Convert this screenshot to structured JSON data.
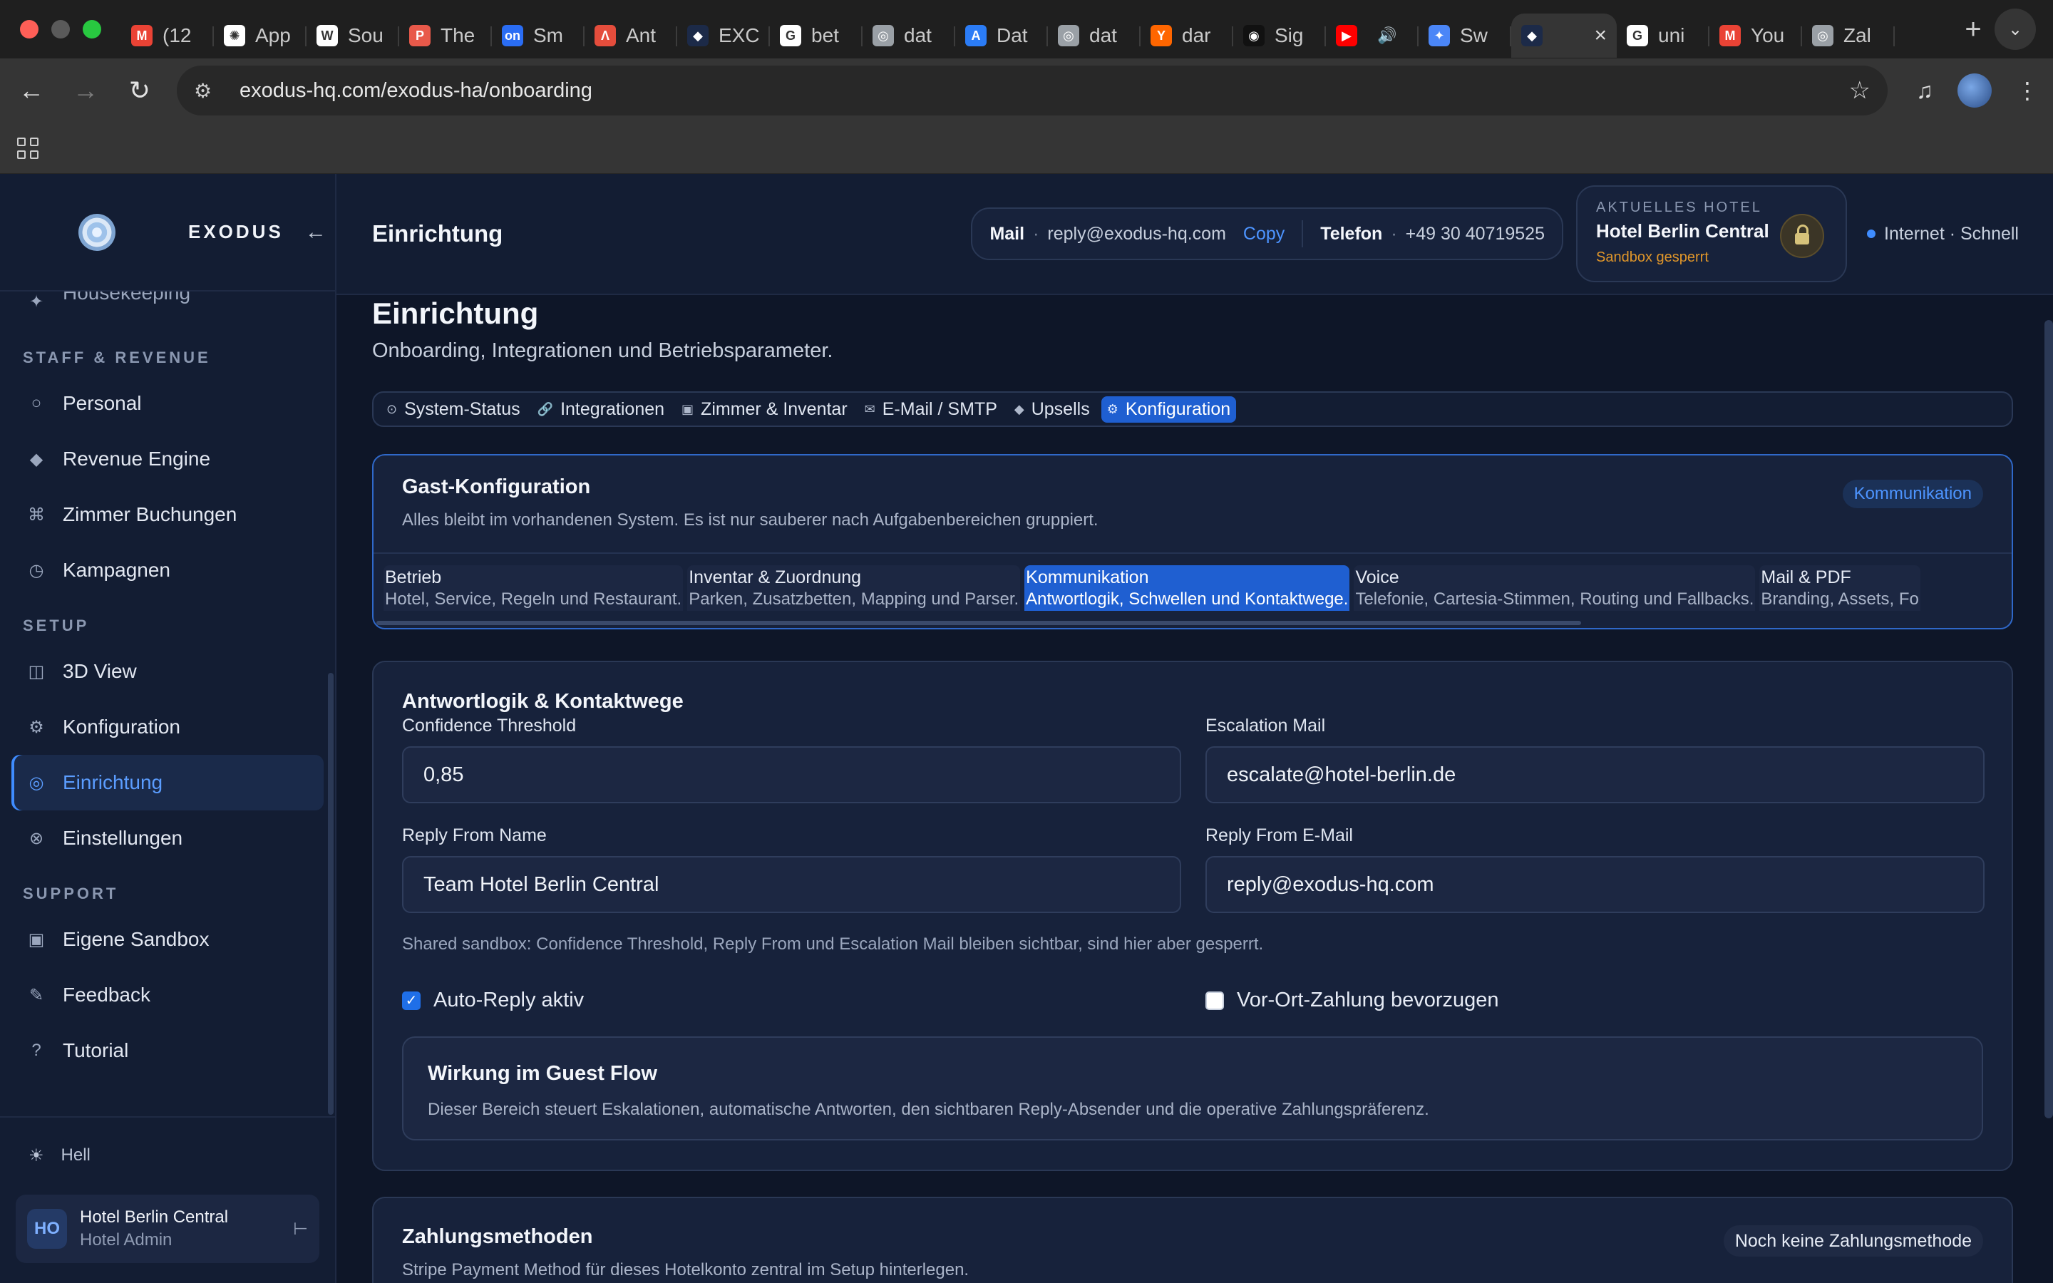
{
  "browser": {
    "tabs": [
      {
        "label": "(12",
        "icon": "gmail-icon",
        "color": "#ea4335",
        "glyph": "M"
      },
      {
        "label": "App",
        "icon": "openai-icon",
        "color": "#ffffff",
        "glyph": "✺"
      },
      {
        "label": "Sou",
        "icon": "wiki-icon",
        "color": "#ffffff",
        "glyph": "W"
      },
      {
        "label": "The",
        "icon": "p-icon",
        "color": "#e8594a",
        "glyph": "P"
      },
      {
        "label": "Sm",
        "icon": "on-icon",
        "color": "#2a6df4",
        "glyph": "on"
      },
      {
        "label": "Ant",
        "icon": "a-icon",
        "color": "#e54d3c",
        "glyph": "Λ"
      },
      {
        "label": "EXC",
        "icon": "exodus-icon",
        "color": "#1c2a48",
        "glyph": "◆"
      },
      {
        "label": "bet",
        "icon": "google-icon",
        "color": "#ffffff",
        "glyph": "G"
      },
      {
        "label": "dat",
        "icon": "globe-icon",
        "color": "#9aa0a6",
        "glyph": "◎"
      },
      {
        "label": "Dat",
        "icon": "appstore-icon",
        "color": "#2b7cf6",
        "glyph": "A"
      },
      {
        "label": "dat",
        "icon": "globe-icon",
        "color": "#9aa0a6",
        "glyph": "◎"
      },
      {
        "label": "dar",
        "icon": "ycombinator-icon",
        "color": "#ff6600",
        "glyph": "Y"
      },
      {
        "label": "Sig",
        "icon": "signal-icon",
        "color": "#111111",
        "glyph": "◉"
      },
      {
        "label": "",
        "icon": "youtube-icon",
        "color": "#ff0000",
        "glyph": "▶"
      },
      {
        "label": "Sw",
        "icon": "gemini-icon",
        "color": "#4b86f7",
        "glyph": "✦"
      },
      {
        "label": "",
        "icon": "exodus-icon",
        "color": "#1c2a48",
        "glyph": "◆",
        "active": true
      },
      {
        "label": "uni",
        "icon": "google-icon",
        "color": "#ffffff",
        "glyph": "G"
      },
      {
        "label": "You",
        "icon": "gmail-icon",
        "color": "#ea4335",
        "glyph": "M"
      },
      {
        "label": "Zal",
        "icon": "globe-icon",
        "color": "#9aa0a6",
        "glyph": "◎"
      }
    ],
    "url": "exodus-hq.com/exodus-ha/onboarding"
  },
  "sidebar": {
    "brand": "EXODUS",
    "partial_item": "Housekeeping",
    "sections": [
      {
        "title": "STAFF & REVENUE",
        "items": [
          {
            "label": "Personal",
            "icon": "○"
          },
          {
            "label": "Revenue Engine",
            "icon": "◆"
          },
          {
            "label": "Zimmer Buchungen",
            "icon": "⌘"
          },
          {
            "label": "Kampagnen",
            "icon": "◷"
          }
        ]
      },
      {
        "title": "SETUP",
        "items": [
          {
            "label": "3D View",
            "icon": "◫"
          },
          {
            "label": "Konfiguration",
            "icon": "⚙"
          },
          {
            "label": "Einrichtung",
            "icon": "◎",
            "active": true
          },
          {
            "label": "Einstellungen",
            "icon": "⊗"
          }
        ]
      },
      {
        "title": "SUPPORT",
        "items": [
          {
            "label": "Eigene Sandbox",
            "icon": "▣"
          },
          {
            "label": "Feedback",
            "icon": "✎"
          },
          {
            "label": "Tutorial",
            "icon": "?"
          }
        ]
      }
    ],
    "theme_label": "Hell",
    "user": {
      "initials": "HO",
      "name": "Hotel Berlin Central",
      "role": "Hotel Admin"
    }
  },
  "topbar": {
    "title": "Einrichtung",
    "mail_key": "Mail",
    "mail_value": "reply@exodus-hq.com",
    "copy_label": "Copy",
    "phone_key": "Telefon",
    "phone_value": "+49 30 40719525",
    "hotel_label": "AKTUELLES HOTEL",
    "hotel_name": "Hotel Berlin Central",
    "hotel_status": "Sandbox gesperrt",
    "net_status": "Internet · Schnell"
  },
  "page": {
    "title": "Einrichtung",
    "subtitle": "Onboarding, Integrationen und Betriebsparameter.",
    "section_nav": [
      {
        "label": "System-Status",
        "icon": "⊙"
      },
      {
        "label": "Integrationen",
        "icon": "🔗"
      },
      {
        "label": "Zimmer & Inventar",
        "icon": "▣"
      },
      {
        "label": "E-Mail / SMTP",
        "icon": "✉"
      },
      {
        "label": "Upsells",
        "icon": "◆"
      },
      {
        "label": "Konfiguration",
        "icon": "⚙",
        "active": true
      }
    ]
  },
  "guest_config": {
    "title": "Gast-Konfiguration",
    "subtitle": "Alles bleibt im vorhandenen System. Es ist nur sauberer nach Aufgabenbereichen gruppiert.",
    "badge": "Kommunikation",
    "tabs": [
      {
        "title": "Betrieb",
        "desc": "Hotel, Service, Regeln und Restaurant."
      },
      {
        "title": "Inventar & Zuordnung",
        "desc": "Parken, Zusatzbetten, Mapping und Parser."
      },
      {
        "title": "Kommunikation",
        "desc": "Antwortlogik, Schwellen und Kontaktwege.",
        "active": true
      },
      {
        "title": "Voice",
        "desc": "Telefonie, Cartesia-Stimmen, Routing und Fallbacks."
      },
      {
        "title": "Mail & PDF",
        "desc": "Branding, Assets, Fo"
      }
    ]
  },
  "form": {
    "title": "Antwortlogik & Kontaktwege",
    "confidence_label": "Confidence Threshold",
    "confidence_value": "0,85",
    "escalation_label": "Escalation Mail",
    "escalation_value": "escalate@hotel-berlin.de",
    "reply_name_label": "Reply From Name",
    "reply_name_value": "Team Hotel Berlin Central",
    "reply_email_label": "Reply From E-Mail",
    "reply_email_value": "reply@exodus-hq.com",
    "hint": "Shared sandbox: Confidence Threshold, Reply From und Escalation Mail bleiben sichtbar, sind hier aber gesperrt.",
    "auto_reply_label": "Auto-Reply aktiv",
    "auto_reply_checked": true,
    "onsite_label": "Vor-Ort-Zahlung bevorzugen",
    "onsite_checked": false,
    "effect_title": "Wirkung im Guest Flow",
    "effect_text": "Dieser Bereich steuert Eskalationen, automatische Antworten, den sichtbaren Reply-Absender und die operative Zahlungspräferenz."
  },
  "payment": {
    "title": "Zahlungsmethoden",
    "subtitle": "Stripe Payment Method für dieses Hotelkonto zentral im Setup hinterlegen.",
    "badge": "Noch keine Zahlungsmethode"
  }
}
